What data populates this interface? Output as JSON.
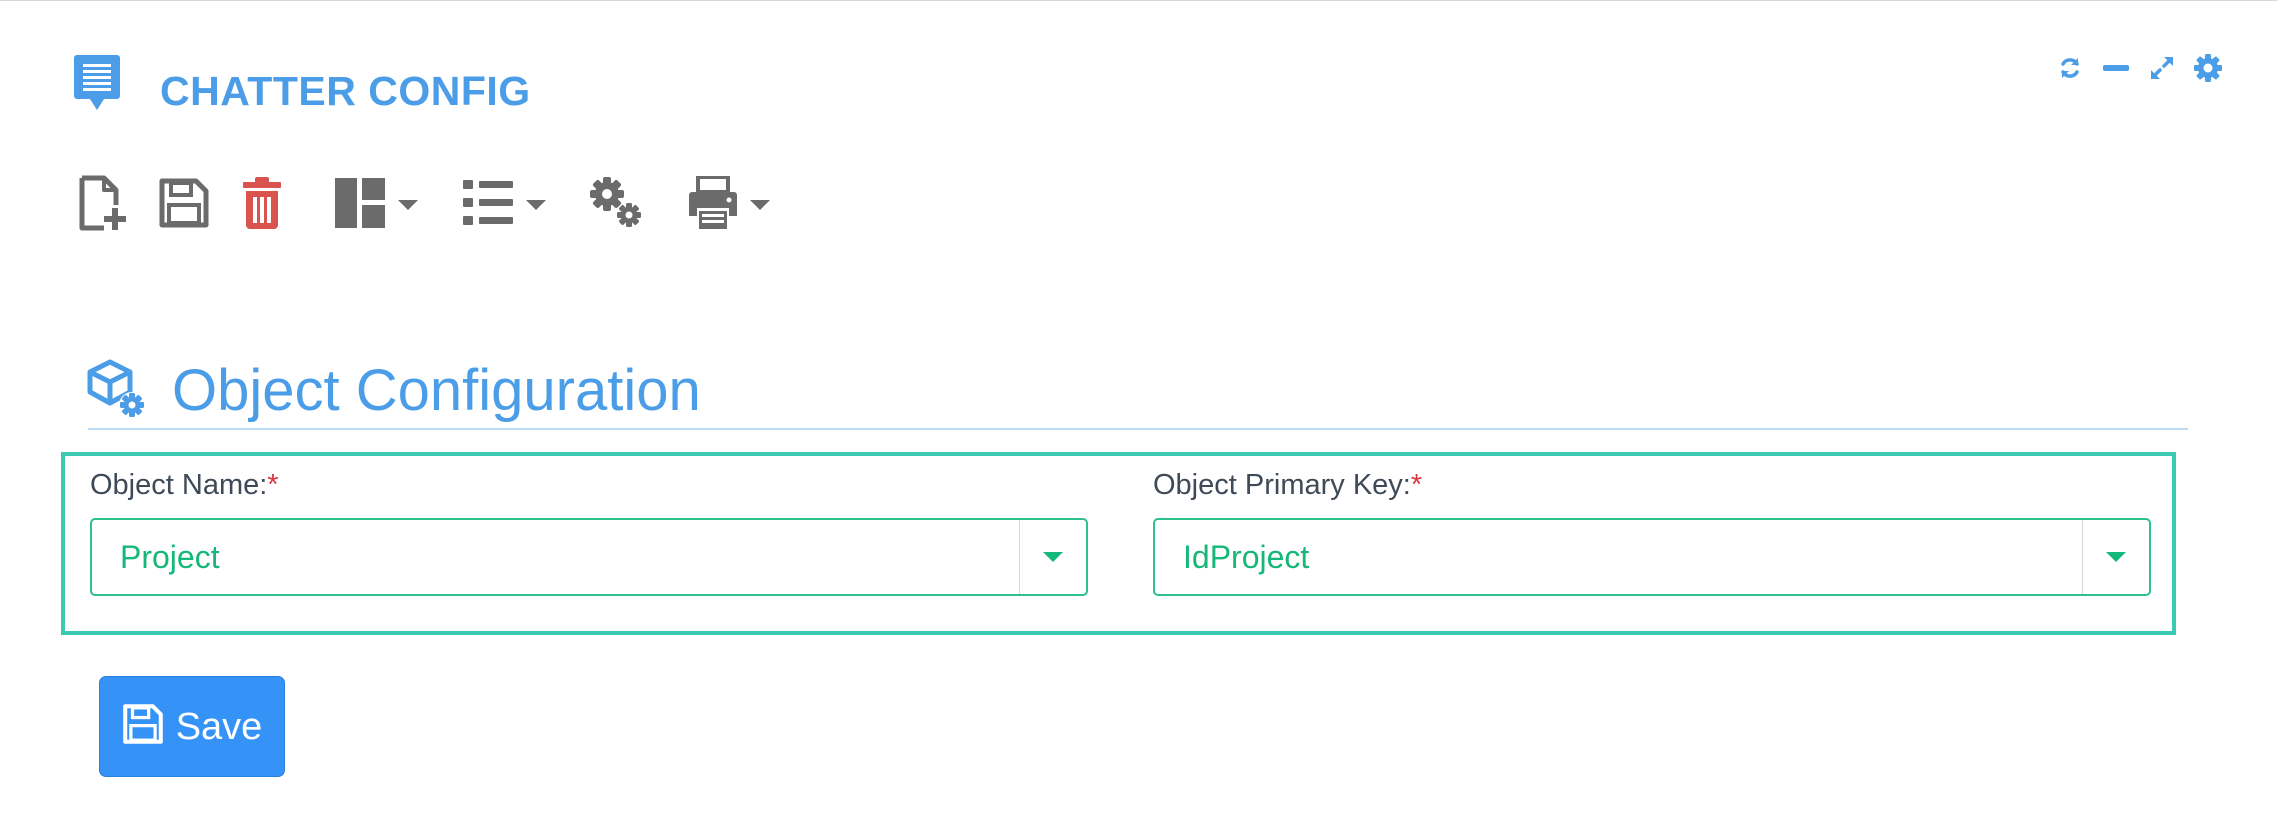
{
  "header": {
    "title": "CHATTER CONFIG",
    "icon": "chat-list-icon",
    "accent_color": "#4a9de6"
  },
  "window_controls": [
    {
      "name": "refresh-icon"
    },
    {
      "name": "minimize-icon"
    },
    {
      "name": "expand-icon"
    },
    {
      "name": "gear-icon"
    }
  ],
  "toolbar": {
    "buttons": [
      {
        "name": "new-document-icon"
      },
      {
        "name": "save-icon"
      },
      {
        "name": "trash-icon",
        "color": "#d9534f"
      },
      {
        "name": "layout-icon",
        "dropdown": true
      },
      {
        "name": "list-icon",
        "dropdown": true
      },
      {
        "name": "cogs-icon"
      },
      {
        "name": "print-icon",
        "dropdown": true
      }
    ],
    "icon_color": "#6b6b6b"
  },
  "section": {
    "title": "Object Configuration",
    "icon": "cube-settings-icon"
  },
  "form": {
    "object_name": {
      "label": "Object Name:",
      "required_mark": "*",
      "value": "Project"
    },
    "object_primary_key": {
      "label": "Object Primary Key:",
      "required_mark": "*",
      "value": "IdProject"
    },
    "border_color": "#3cc9b4",
    "value_color": "#16b77a"
  },
  "save_button": {
    "label": "Save",
    "background": "#3593f7"
  }
}
